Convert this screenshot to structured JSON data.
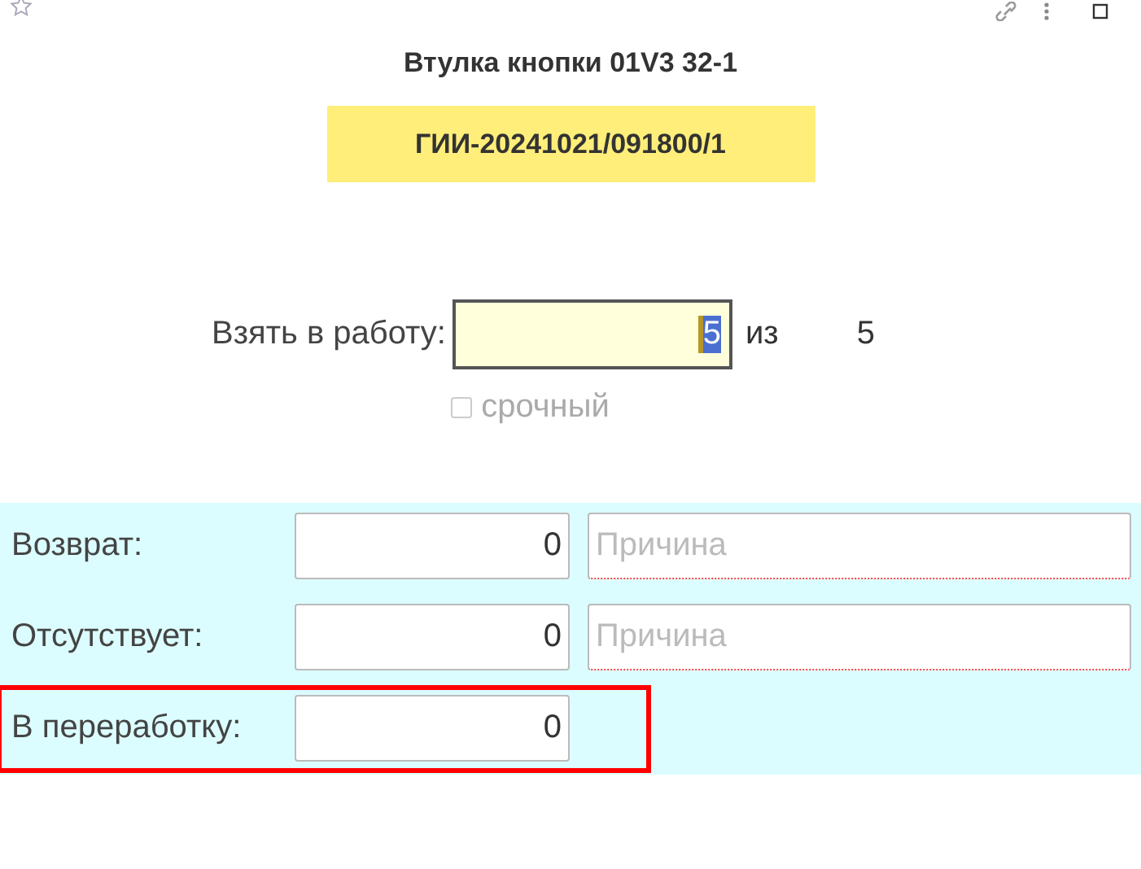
{
  "title": "Втулка кнопки 01V3 32-1",
  "document": "ГИИ-20241021/091800/1",
  "take": {
    "label": "Взять в работу:",
    "value": "5",
    "value_selected": true,
    "of_label": "из",
    "total": "5"
  },
  "urgent": {
    "label": "срочный",
    "checked": false,
    "disabled": true
  },
  "rows": [
    {
      "label": "Возврат:",
      "value": "0",
      "reason_placeholder": "Причина",
      "highlighted": false
    },
    {
      "label": "Отсутствует:",
      "value": "0",
      "reason_placeholder": "Причина",
      "highlighted": false
    },
    {
      "label": "В переработку:",
      "value": "0",
      "highlighted": true
    }
  ]
}
